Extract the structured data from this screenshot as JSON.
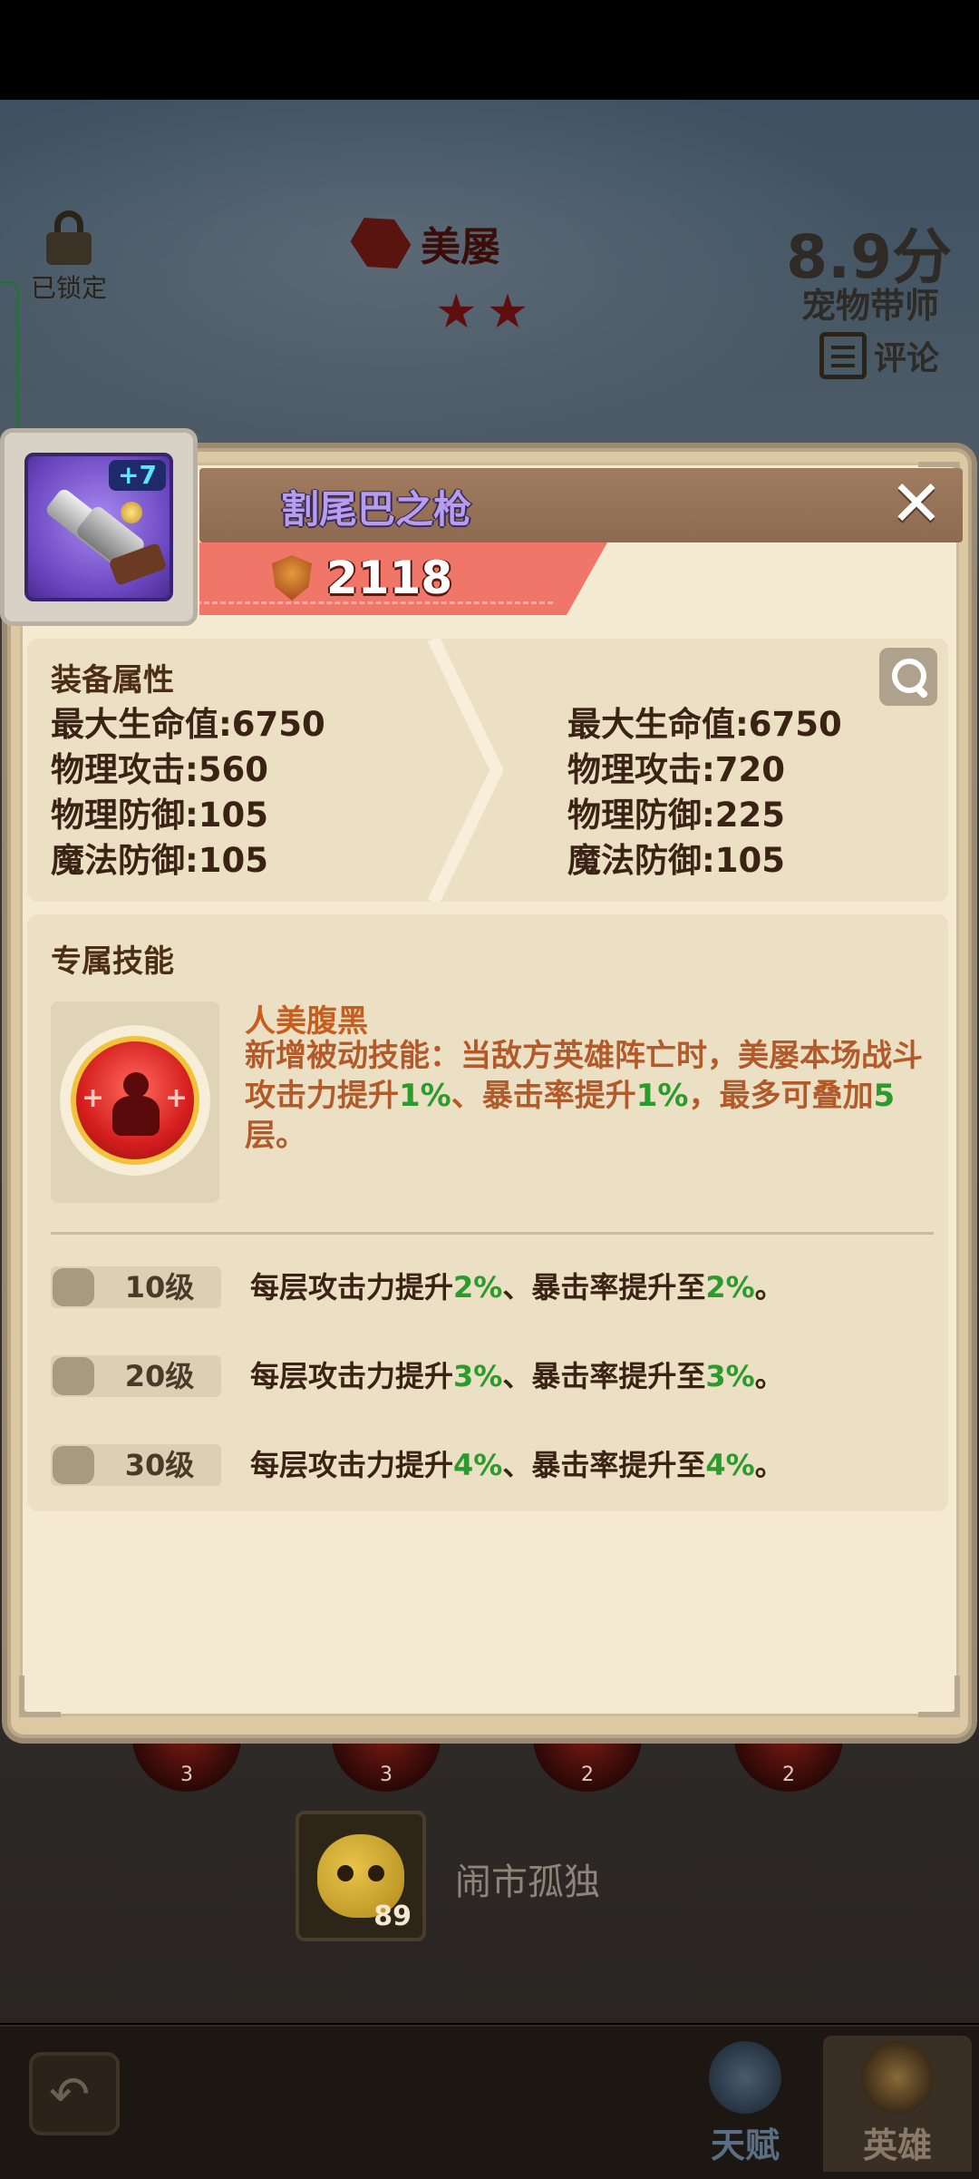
{
  "status_bar": {},
  "background": {
    "lock_label": "已锁定",
    "hero_name": "美屡",
    "stars": 2,
    "score": "8.9分",
    "rating_label": "宠物带师",
    "comment_label": "评论",
    "skill_counts": [
      "3",
      "3",
      "2",
      "2"
    ],
    "pet_level": "89",
    "pet_name": "闹市孤独",
    "tabs": [
      "天赋",
      "英雄"
    ]
  },
  "modal": {
    "item_name": "割尾巴之枪",
    "enhance_level": "+7",
    "power": "2118",
    "close_label": "✕",
    "stats_title": "装备属性",
    "stats_current": [
      "最大生命值:6750",
      "物理攻击:560",
      "物理防御:105",
      "魔法防御:105"
    ],
    "stats_next": [
      "最大生命值:6750",
      "物理攻击:720",
      "物理防御:225",
      "魔法防御:105"
    ],
    "skill_section_title": "专属技能",
    "skill_name": "人美腹黑",
    "skill_desc": {
      "p1": "新增被动技能：当敌方英雄阵亡时，美屡本场战斗攻击力提升",
      "v1": "1%",
      "p2": "、暴击率提升",
      "v2": "1%",
      "p3": "，最多可叠加",
      "v3": "5",
      "p4": "层。"
    },
    "levels": [
      {
        "label": "10级",
        "t1": "每层攻击力提升",
        "v1": "2%",
        "t2": "、暴击率提升至",
        "v2": "2%",
        "t3": "。"
      },
      {
        "label": "20级",
        "t1": "每层攻击力提升",
        "v1": "3%",
        "t2": "、暴击率提升至",
        "v2": "3%",
        "t3": "。"
      },
      {
        "label": "30级",
        "t1": "每层攻击力提升",
        "v1": "4%",
        "t2": "、暴击率提升至",
        "v2": "4%",
        "t3": "。"
      }
    ]
  },
  "colors": {
    "highlight_green": "#2c9a2c",
    "skill_name_orange": "#c85e1e",
    "power_band": "#ef7668",
    "item_name_purple": "#b79df0"
  }
}
